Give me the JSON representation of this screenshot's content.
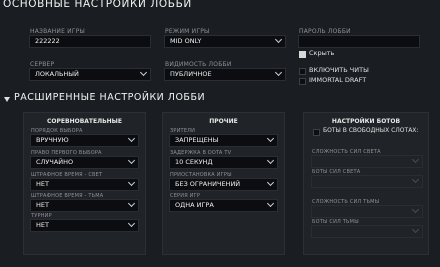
{
  "basic": {
    "title": "ОСНОВНЫЕ НАСТРОЙКИ ЛОББИ",
    "game_name_label": "НАЗВАНИЕ ИГРЫ",
    "game_name_value": "222222",
    "game_mode_label": "РЕЖИМ ИГРЫ",
    "game_mode_value": "MID ONLY",
    "password_label": "ПАРОЛЬ ЛОББИ",
    "password_value": "",
    "hide_label": "Скрыть",
    "hide_checked": true,
    "server_label": "СЕРВЕР",
    "server_value": "ЛОКАЛЬНЫЙ",
    "visibility_label": "ВИДИМОСТЬ ЛОББИ",
    "visibility_value": "ПУБЛИЧНОЕ",
    "cheats_label": "ВКЛЮЧИТЬ ЧИТЫ",
    "cheats_checked": false,
    "immortal_label": "IMMORTAL DRAFT",
    "immortal_checked": false
  },
  "advanced": {
    "title": "РАСШИРЕННЫЕ НАСТРОЙКИ ЛОББИ",
    "competitive": {
      "title": "СОРЕВНОВАТЕЛЬНЫЕ",
      "fields": [
        {
          "label": "ПОРЯДОК ВЫБОРА",
          "value": "ВРУЧНУЮ"
        },
        {
          "label": "ПРАВО ПЕРВОГО ВЫБОРА",
          "value": "СЛУЧАЙНО"
        },
        {
          "label": "ШТРАФНОЕ ВРЕМЯ - СВЕТ",
          "value": "НЕТ"
        },
        {
          "label": "ШТРАФНОЕ ВРЕМЯ - ТЬМА",
          "value": "НЕТ"
        },
        {
          "label": "ТУРНИР",
          "value": "НЕТ"
        }
      ]
    },
    "other": {
      "title": "ПРОЧИЕ",
      "fields": [
        {
          "label": "ЗРИТЕЛИ",
          "value": "ЗАПРЕЩЕНЫ"
        },
        {
          "label": "ЗАДЕРЖКА В DOTA TV",
          "value": "10 СЕКУНД"
        },
        {
          "label": "ПРИОСТАНОВКА ИГРЫ",
          "value": "БЕЗ ОГРАНИЧЕНИЙ"
        },
        {
          "label": "СЕРИЯ ИГР",
          "value": "ОДНА ИГРА"
        }
      ]
    },
    "bots": {
      "title": "НАСТРОЙКИ БОТОВ",
      "free_slots_label": "БОТЫ В СВОБОДНЫХ СЛОТАХ:",
      "free_slots_checked": false,
      "fields": [
        {
          "label": "СЛОЖНОСТЬ СИЛ СВЕТА",
          "value": ""
        },
        {
          "label": "БОТЫ СИЛ СВЕТА",
          "value": ""
        },
        {
          "label": "СЛОЖНОСТЬ СИЛ ТЬМЫ",
          "value": ""
        },
        {
          "label": "БОТЫ СИЛ ТЬМЫ",
          "value": ""
        }
      ]
    }
  }
}
